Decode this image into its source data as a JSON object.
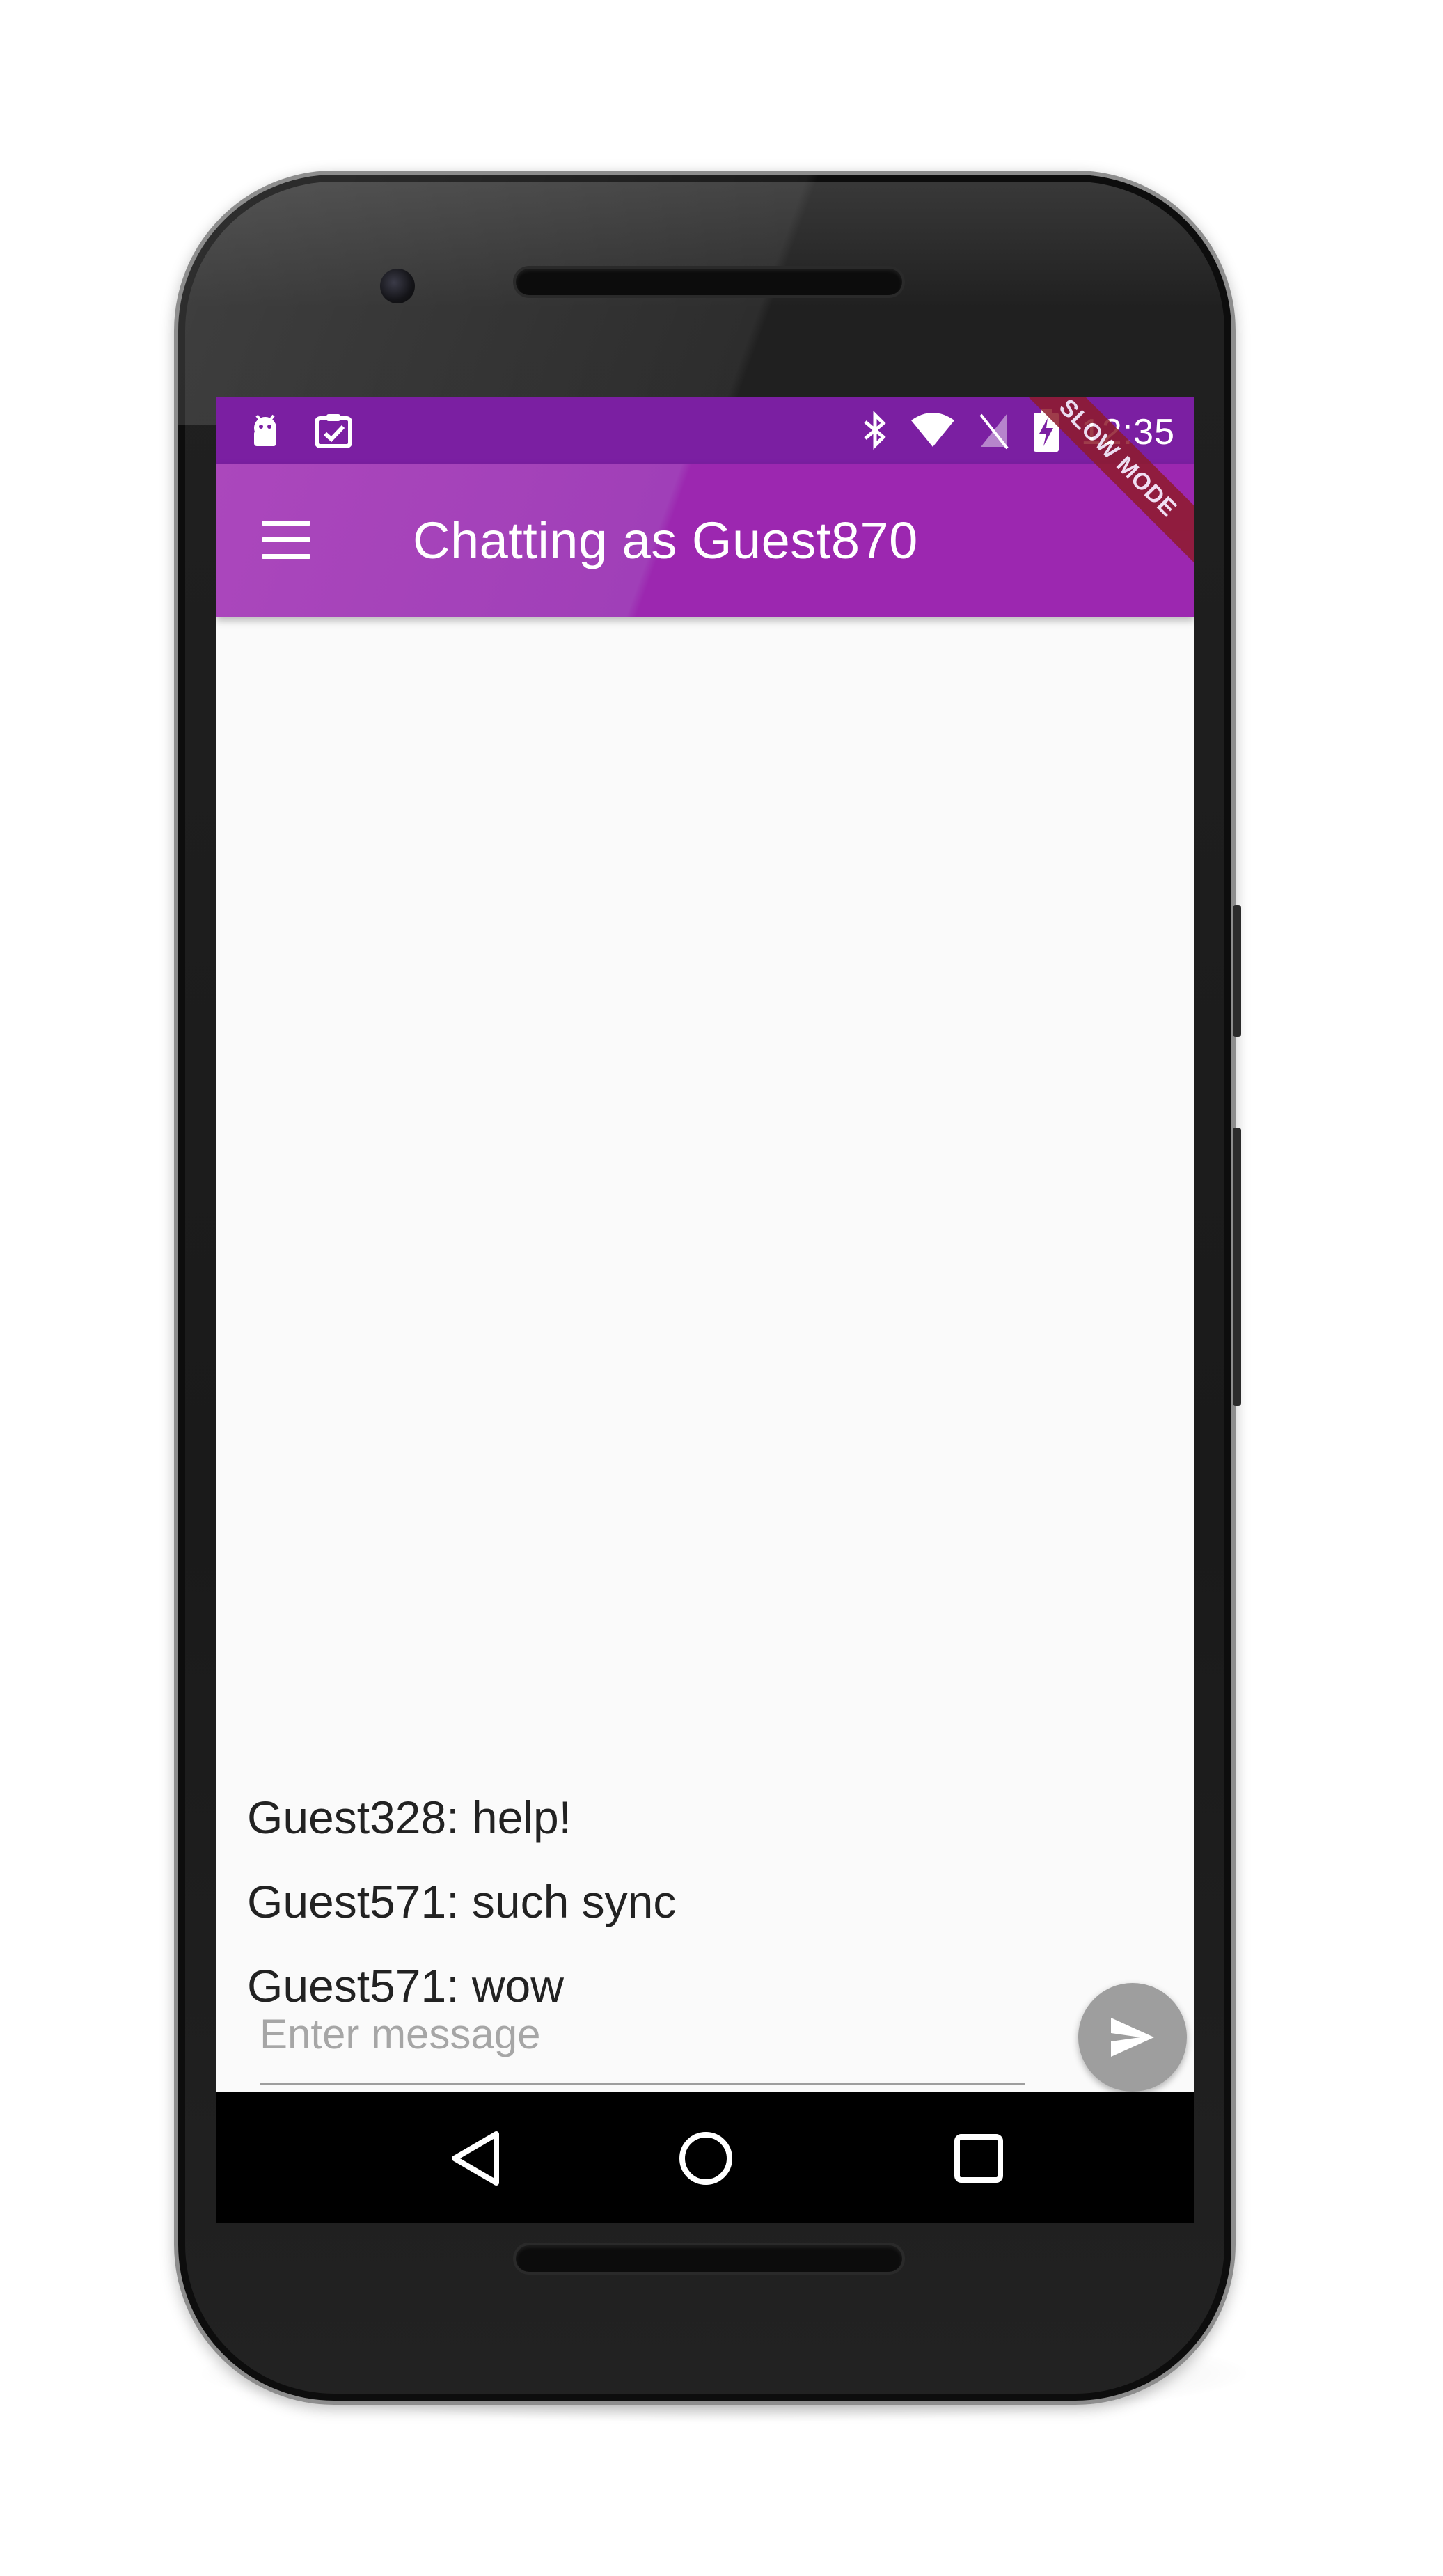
{
  "status_bar": {
    "time": "12:35",
    "left_icons": [
      "android-debug-icon",
      "clipboard-check-icon"
    ],
    "right_icons": [
      "bluetooth-icon",
      "wifi-icon",
      "no-sim-icon",
      "battery-charging-icon"
    ]
  },
  "debug_banner": "SLOW MODE",
  "app_bar": {
    "title": "Chatting as Guest870",
    "menu_icon": "menu-icon"
  },
  "messages": [
    {
      "text": "Guest328: help!"
    },
    {
      "text": "Guest571: such sync"
    },
    {
      "text": "Guest571: wow"
    }
  ],
  "composer": {
    "placeholder": "Enter message",
    "value": ""
  },
  "send_button_icon": "send-icon",
  "nav_bar": [
    "back-icon",
    "home-icon",
    "recents-icon"
  ],
  "colors": {
    "app_bar": "#9c27b0",
    "status_bar": "#7b1fa2",
    "background": "#fafafa",
    "send_button": "#9e9e9e",
    "banner": "#8e1b2b"
  }
}
